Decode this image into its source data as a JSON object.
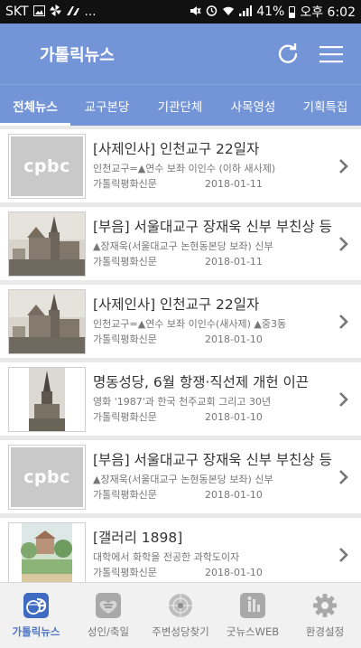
{
  "status_bar": {
    "carrier": "SKT",
    "notification_icons": [
      "image-icon",
      "pinwheel-icon",
      "battery-saver-icon",
      "more-icon"
    ],
    "battery_percent": "41%",
    "time": "오후 6:02"
  },
  "header": {
    "title": "가톨릭뉴스",
    "refresh_icon": "refresh-icon",
    "menu_icon": "hamburger-menu-icon",
    "color": "#7394d6"
  },
  "tabs": [
    {
      "label": "전체뉴스",
      "active": true
    },
    {
      "label": "교구본당",
      "active": false
    },
    {
      "label": "기관단체",
      "active": false
    },
    {
      "label": "사목영성",
      "active": false
    },
    {
      "label": "기획특집",
      "active": false
    }
  ],
  "news": [
    {
      "thumb": "cpbc-logo",
      "thumb_text": "cpbc",
      "title": "[사제인사] 인천교구 22일자",
      "summary": "인천교구=▲연수 보좌 이인수 (이하 새사제)",
      "source": "가톨릭평화신문",
      "date": "2018-01-11"
    },
    {
      "thumb": "cathedral-photo",
      "title": "[부음] 서울대교구 장재욱 신부 부친상 등",
      "summary": "▲장재욱(서울대교구 논현동본당 보좌) 신부",
      "source": "가톨릭평화신문",
      "date": "2018-01-11"
    },
    {
      "thumb": "cathedral-photo",
      "title": "[사제인사] 인천교구 22일자",
      "summary": "인천교구=▲연수 보좌 이인수(새사제) ▲중3동",
      "source": "가톨릭평화신문",
      "date": "2018-01-10"
    },
    {
      "thumb": "cathedral-tower-photo",
      "title": "명동성당, 6월 항쟁·직선제 개헌 이끈",
      "summary": "영화 '1987'과 한국 천주교회 그리고 30년",
      "source": "가톨릭평화신문",
      "date": "2018-01-10"
    },
    {
      "thumb": "cpbc-logo",
      "thumb_text": "cpbc",
      "title": "[부음] 서울대교구 장재욱 신부 부친상 등",
      "summary": "▲장재욱(서울대교구 논현동본당 보좌) 신부",
      "source": "가톨릭평화신문",
      "date": "2018-01-10"
    },
    {
      "thumb": "painting-photo",
      "title": "[갤러리 1898]",
      "summary": "대학에서 화학을 전공한 과학도이자",
      "source": "가톨릭평화신문",
      "date": "2018-01-10"
    }
  ],
  "bottom_nav": [
    {
      "label": "가톨릭뉴스",
      "icon": "catholic-news-icon",
      "active": true
    },
    {
      "label": "성인/축일",
      "icon": "saints-icon",
      "active": false
    },
    {
      "label": "주변성당찾기",
      "icon": "nearby-church-icon",
      "active": false
    },
    {
      "label": "굿뉴스WEB",
      "icon": "goodnews-web-icon",
      "active": false
    },
    {
      "label": "환경설정",
      "icon": "settings-gear-icon",
      "active": false
    }
  ]
}
